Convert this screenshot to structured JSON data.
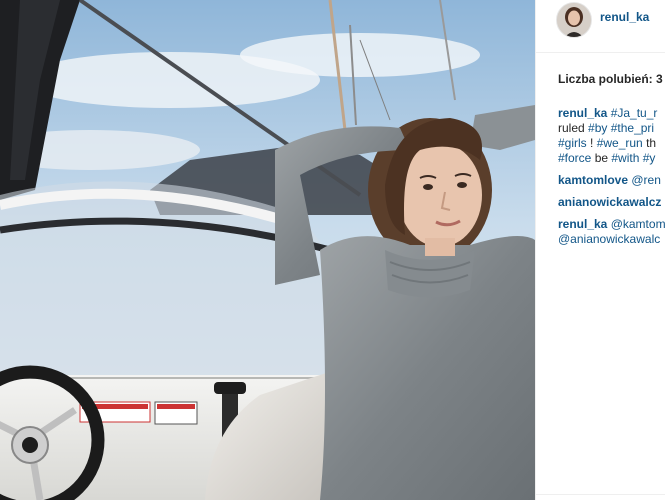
{
  "post": {
    "owner_username": "renul_ka",
    "likes_label": "Liczba polubień: 3",
    "comments": [
      {
        "username": "renul_ka",
        "lines": [
          [
            {
              "t": "tag",
              "v": "#Ja_tu_r"
            }
          ],
          [
            {
              "t": "text",
              "v": "ruled "
            },
            {
              "t": "tag",
              "v": "#by #the_pri"
            }
          ],
          [
            {
              "t": "tag",
              "v": "#girls"
            },
            {
              "t": "text",
              "v": " ! "
            },
            {
              "t": "tag",
              "v": "#we_run"
            },
            {
              "t": "text",
              "v": " th"
            }
          ],
          [
            {
              "t": "tag",
              "v": "#force"
            },
            {
              "t": "text",
              "v": " be "
            },
            {
              "t": "tag",
              "v": "#with #y"
            }
          ]
        ]
      },
      {
        "username": "kamtomlove",
        "lines": [
          [
            {
              "t": "tag",
              "v": "@ren"
            }
          ]
        ]
      },
      {
        "username": "anianowickawalcz",
        "lines": []
      },
      {
        "username": "renul_ka",
        "lines": [
          [
            {
              "t": "tag",
              "v": "@kamtom"
            }
          ],
          [
            {
              "t": "tag",
              "v": "@anianowickawalc"
            }
          ]
        ]
      }
    ]
  },
  "colors": {
    "username": "#125688",
    "hashtag": "#125688",
    "text": "#262626",
    "divider": "#efefef"
  },
  "icons": {
    "avatar": "profile-photo"
  }
}
